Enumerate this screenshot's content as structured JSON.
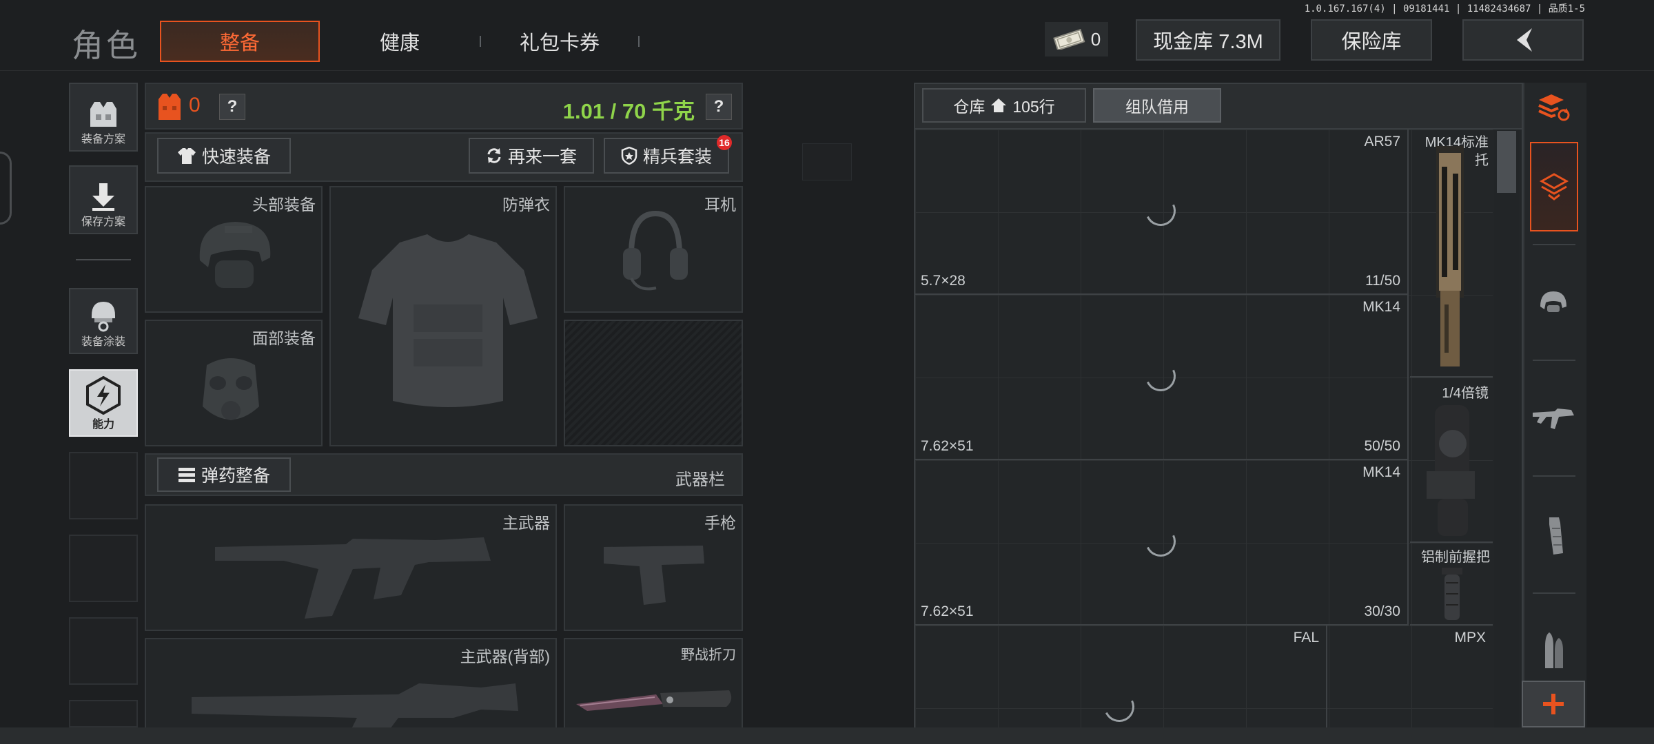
{
  "version_info": "1.0.167.167(4) | 09181441 | 11482434687 | 品质1-5",
  "header": {
    "title": "角色",
    "tabs": [
      {
        "label": "整备",
        "active": true
      },
      {
        "label": "健康",
        "active": false
      },
      {
        "label": "礼包卡券",
        "active": false
      }
    ],
    "money_count": "0",
    "cash_vault": "现金库 7.3M",
    "safe_box": "保险库"
  },
  "sidebar": {
    "items": [
      {
        "label": "装备方案",
        "icon": "vest-icon"
      },
      {
        "label": "保存方案",
        "icon": "download-icon"
      },
      {
        "label": "装备涂装",
        "icon": "helmet-paint-icon"
      },
      {
        "label": "能力",
        "icon": "lightning-badge-icon",
        "active": true
      }
    ]
  },
  "loadout": {
    "armor_count": "0",
    "help_symbol": "?",
    "weight": "1.01 / 70 千克",
    "quick_equip": "快速装备",
    "again_set": "再来一套",
    "elite_set": "精兵套装",
    "elite_badge": "16",
    "slots": {
      "head": "头部装备",
      "armor": "防弹衣",
      "headset": "耳机",
      "face": "面部装备"
    },
    "ammo_button": "弹药整备",
    "weapon_bar": "武器栏",
    "weapon_slots": {
      "primary": "主武器",
      "pistol": "手枪",
      "primary_back": "主武器(背部)",
      "knife": "野战折刀"
    }
  },
  "warehouse": {
    "tab_storage": "仓库",
    "storage_rows": "105行",
    "tab_team": "组队借用",
    "rows": [
      {
        "name": "AR57",
        "ammo": "5.7×28",
        "count": "11/50"
      },
      {
        "name": "MK14",
        "ammo": "7.62×51",
        "count": "50/50"
      },
      {
        "name": "MK14",
        "ammo": "7.62×51",
        "count": "30/30"
      },
      {
        "name": "FAL",
        "ammo": "",
        "count": ""
      }
    ],
    "side_items": [
      {
        "name": "MK14标准托"
      },
      {
        "name": "1/4倍镜"
      },
      {
        "name": "铝制前握把"
      },
      {
        "name": "MPX"
      }
    ]
  },
  "colors": {
    "accent": "#e8531f",
    "weight_green": "#8fd44a",
    "badge_red": "#e02a2a"
  }
}
